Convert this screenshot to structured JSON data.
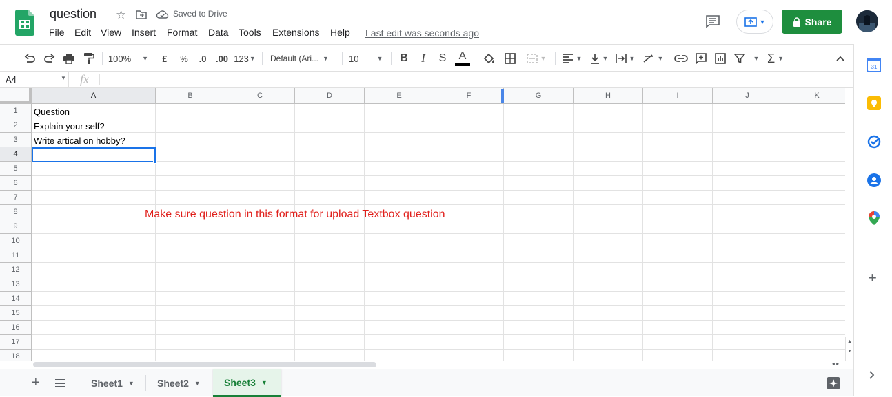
{
  "app": {
    "title": "question",
    "saved_status": "Saved to Drive",
    "last_edit": "Last edit was seconds ago"
  },
  "menu": [
    "File",
    "Edit",
    "View",
    "Insert",
    "Format",
    "Data",
    "Tools",
    "Extensions",
    "Help"
  ],
  "share_label": "Share",
  "toolbar": {
    "zoom": "100%",
    "currency": "£",
    "percent": "%",
    "dec_less": ".0",
    "dec_more": ".00",
    "number_format": "123",
    "font": "Default (Ari...",
    "font_size": "10"
  },
  "formula_bar": {
    "name_box": "A4",
    "fx": "fx",
    "value": ""
  },
  "columns": [
    "A",
    "B",
    "C",
    "D",
    "E",
    "F",
    "G",
    "H",
    "I",
    "J",
    "K"
  ],
  "rows": [
    "1",
    "2",
    "3",
    "4",
    "5",
    "6",
    "7",
    "8",
    "9",
    "10",
    "11",
    "12",
    "13",
    "14",
    "15",
    "16",
    "17",
    "18"
  ],
  "cells": {
    "A1": "Question",
    "A2": "Explain your self?",
    "A3": "Write artical on hobby?"
  },
  "annotation": "Make sure question in this format for upload Textbox question",
  "annotation_color": "#e0201c",
  "selected_cell": "A4",
  "sheets": [
    "Sheet1",
    "Sheet2",
    "Sheet3"
  ],
  "active_sheet": "Sheet3",
  "accent_color": "#1e8e3e"
}
